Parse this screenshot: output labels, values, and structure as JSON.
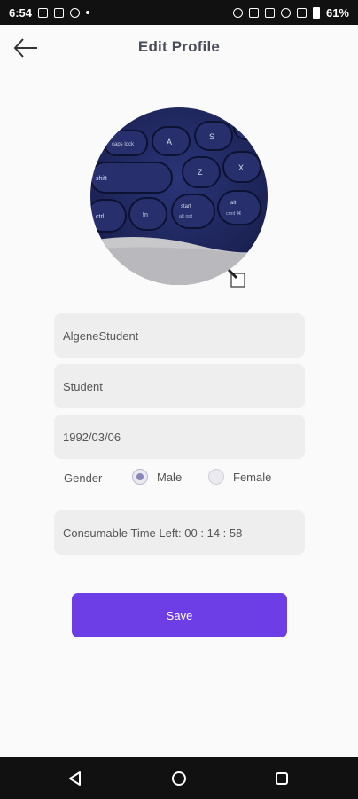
{
  "status_bar": {
    "time": "6:54",
    "battery": "61%"
  },
  "header": {
    "title": "Edit Profile",
    "back_icon": "arrow-left-icon"
  },
  "profile": {
    "photo_description_icon": "keyboard-photo",
    "edit_photo_icon": "pencil-icon",
    "keys": {
      "caps": "caps lock",
      "a": "A",
      "s": "S",
      "shift": "shift",
      "z": "Z",
      "x": "X",
      "ctrl": "ctrl",
      "fn": "fn",
      "start_top": "start",
      "start_bottom": "alt opt",
      "alt_top": "alt",
      "alt_bottom": "cmd ⌘"
    }
  },
  "form": {
    "username": "AlgeneStudent",
    "role": "Student",
    "birthdate": "1992/03/06",
    "gender_label": "Gender",
    "gender_options": [
      {
        "label": "Male",
        "selected": true
      },
      {
        "label": "Female",
        "selected": false
      }
    ],
    "consumable_time": "Consumable Time Left: 00 : 14 : 58"
  },
  "actions": {
    "save_label": "Save"
  },
  "colors": {
    "accent": "#6d3de6",
    "field_bg": "#eeeeee",
    "radio_checked": "#8a87b8"
  },
  "nav": {
    "back_icon": "triangle-back-icon",
    "home_icon": "circle-home-icon",
    "recents_icon": "square-recents-icon"
  }
}
